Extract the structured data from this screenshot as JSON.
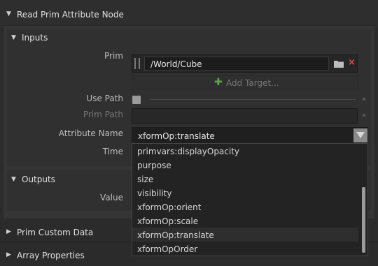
{
  "node": {
    "title": "Read Prim Attribute Node",
    "inputs": {
      "title": "Inputs",
      "prim_label": "Prim",
      "prim_value": "/World/Cube",
      "add_target_label": "Add Target...",
      "use_path_label": "Use Path",
      "prim_path_label": "Prim Path",
      "attribute_name_label": "Attribute Name",
      "attribute_name_value": "xformOp:translate",
      "time_label": "Time"
    },
    "outputs": {
      "title": "Outputs",
      "value_label": "Value"
    },
    "prim_custom_data": "Prim Custom Data",
    "array_properties": "Array Properties"
  },
  "dropdown": {
    "options": [
      "primvars:displayOpacity",
      "purpose",
      "size",
      "visibility",
      "xformOp:orient",
      "xformOp:scale",
      "xformOp:translate",
      "xformOpOrder"
    ],
    "selected": "xformOp:translate"
  },
  "colors": {
    "accent_remove": "#d9534f",
    "add_plus": "#59a64b",
    "background": "#2b2b2b"
  }
}
